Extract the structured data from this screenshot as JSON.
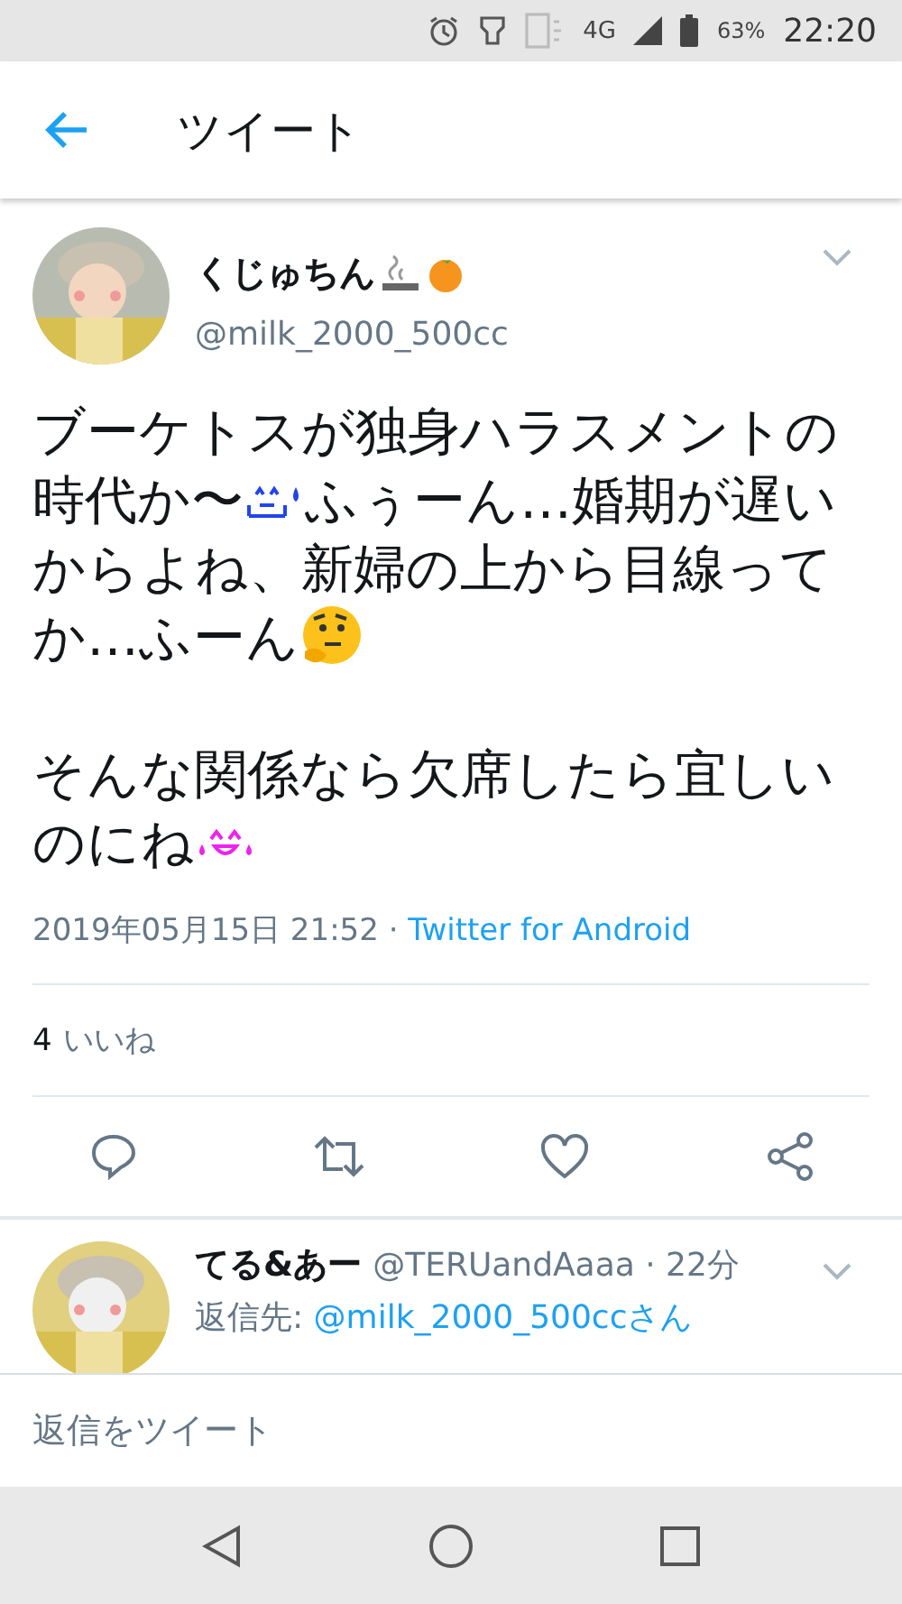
{
  "status_bar": {
    "network": "4G",
    "battery": "63%",
    "time": "22:20"
  },
  "header": {
    "title": "ツイート"
  },
  "tweet": {
    "author": "くじゅちん",
    "handle": "@milk_2000_500cc",
    "body": [
      [
        [
          {
            "kind": "text",
            "text": "ブーケトスが独身ハラスメントの"
          }
        ],
        [
          {
            "kind": "text",
            "text": "時代か〜"
          },
          {
            "kind": "sweat"
          },
          {
            "kind": "text",
            "text": "ふぅーん…婚期が遅い"
          }
        ],
        [
          {
            "kind": "text",
            "text": "からよね、新婦の上から目線って"
          }
        ],
        [
          {
            "kind": "text",
            "text": "か…ふーん"
          },
          {
            "kind": "thinking"
          }
        ]
      ],
      [
        [
          {
            "kind": "text",
            "text": "そんな関係なら欠席したら宜しい"
          }
        ],
        [
          {
            "kind": "text",
            "text": "のにね"
          },
          {
            "kind": "laugh"
          }
        ]
      ]
    ],
    "timestamp": "2019年05月15日 21:52 · ",
    "source": "Twitter for Android",
    "like_count": "4",
    "like_label": "いいね"
  },
  "reply": {
    "author": "てる&あー",
    "handle": "@TERUandAaaa · 22分",
    "reply_to_label": "返信先: ",
    "reply_to": "@milk_2000_500ccさん"
  },
  "compose": {
    "placeholder": "返信をツイート"
  }
}
